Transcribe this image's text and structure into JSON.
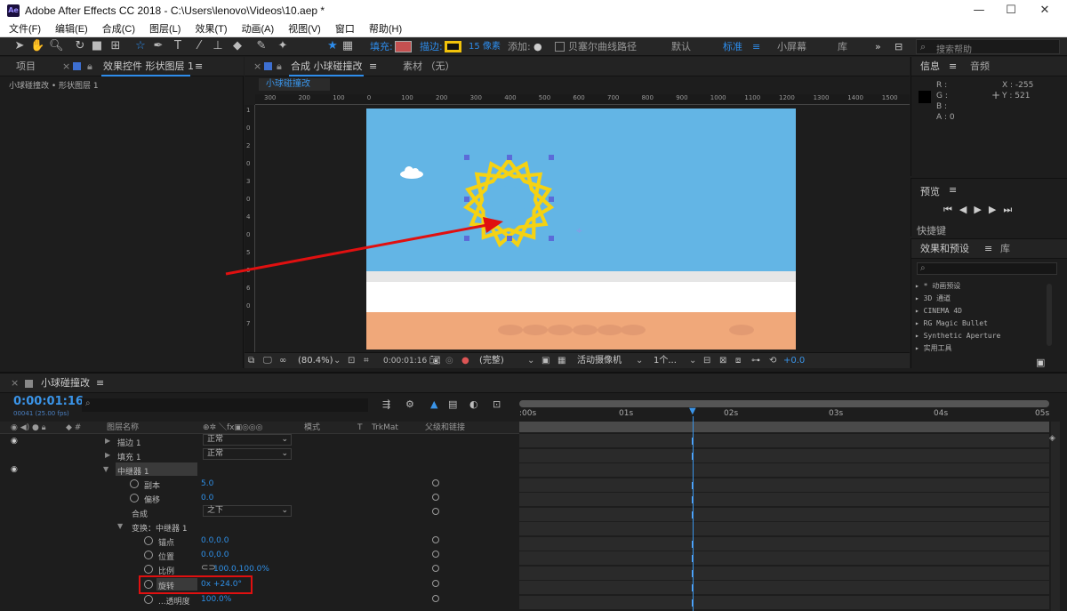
{
  "window": {
    "title": "Adobe After Effects CC 2018 - C:\\Users\\lenovo\\Videos\\10.aep *",
    "logo": "Ae",
    "minimize": "—",
    "maximize": "☐",
    "close": "✕"
  },
  "menu": [
    "文件(F)",
    "编辑(E)",
    "合成(C)",
    "图层(L)",
    "效果(T)",
    "动画(A)",
    "视图(V)",
    "窗口",
    "帮助(H)"
  ],
  "toolbar": {
    "fill_label": "填充:",
    "stroke_label": "描边:",
    "stroke_size": "15 像素",
    "add_label": "添加:",
    "bezier_label": "贝塞尔曲线路径",
    "workspace_default": "默认",
    "workspace_standard": "标准",
    "workspace_small": "小屏幕",
    "workspace_library": "库",
    "search_placeholder": "搜索帮助",
    "fill_color": "#c45050",
    "stroke_color": "#f1c20a"
  },
  "left_panel": {
    "tab_project": "项目",
    "tab_effects": "效果控件 形状图层 1",
    "breadcrumb": "小球碰撞改 • 形状图层 1"
  },
  "comp_panel": {
    "tab_comp": "合成 小球碰撞改",
    "tab_footage": "素材 （无）",
    "comp_chip": "小球碰撞改",
    "ruler_labels": [
      "300",
      "200",
      "100",
      "0",
      "100",
      "200",
      "300",
      "400",
      "500",
      "600",
      "700",
      "800",
      "900",
      "1000",
      "1100",
      "1200",
      "1300",
      "1400",
      "1500"
    ],
    "vruler_labels": [
      "1",
      "0",
      "2",
      "0",
      "3",
      "0",
      "4",
      "0",
      "5",
      "0",
      "6",
      "0",
      "7"
    ],
    "zoom": "(80.4%)",
    "timecode": "0:00:01:16",
    "resolution": "(完整)",
    "camera": "活动摄像机",
    "views": "1个...",
    "exposure": "+0.0",
    "sky_color": "#63b5e5",
    "ground_color": "#f0a87a",
    "star_color": "#f5d213"
  },
  "info_panel": {
    "tab_info": "信息",
    "tab_audio": "音频",
    "r": "R :",
    "g": "G :",
    "b": "B :",
    "a": "A : 0",
    "x": "X : -255",
    "y": "Y : 521"
  },
  "preview_panel": {
    "title": "预览",
    "shortcut": "快捷键"
  },
  "effects_panel": {
    "tab_effects": "效果和预设",
    "tab_library": "库",
    "items": [
      "* 动画预设",
      "3D 通道",
      "CINEMA 4D",
      "RG Magic Bullet",
      "Synthetic Aperture",
      "实用工具"
    ]
  },
  "timeline": {
    "tab": "小球碰撞改",
    "timecode": "0:00:01:16",
    "frame_info": "00041 (25.00 fps)",
    "col_layer": "图层名称",
    "col_mode": "模式",
    "col_t": "T",
    "col_trkmat": "TrkMat",
    "col_parent": "父级和链接",
    "time_labels": [
      ":00s",
      "01s",
      "02s",
      "03s",
      "04s",
      "05s"
    ],
    "rows": [
      {
        "label": "描边 1",
        "value": "正常",
        "kind": "dd"
      },
      {
        "label": "填充 1",
        "value": "正常",
        "kind": "dd"
      },
      {
        "label": "中继器 1",
        "value": "",
        "kind": "group"
      },
      {
        "label": "副本",
        "value": "5.0",
        "kind": "prop"
      },
      {
        "label": "偏移",
        "value": "0.0",
        "kind": "prop"
      },
      {
        "label": "合成",
        "value": "之下",
        "kind": "dd"
      },
      {
        "label": "变换：中继器 1",
        "value": "",
        "kind": "group"
      },
      {
        "label": "锚点",
        "value": "0.0,0.0",
        "kind": "prop"
      },
      {
        "label": "位置",
        "value": "0.0,0.0",
        "kind": "prop"
      },
      {
        "label": "比例",
        "value": "100.0,100.0%",
        "kind": "prop"
      },
      {
        "label": "旋转",
        "value": "0x +24.0°",
        "kind": "prop"
      },
      {
        "label": "...透明度",
        "value": "100.0%",
        "kind": "prop"
      }
    ]
  }
}
